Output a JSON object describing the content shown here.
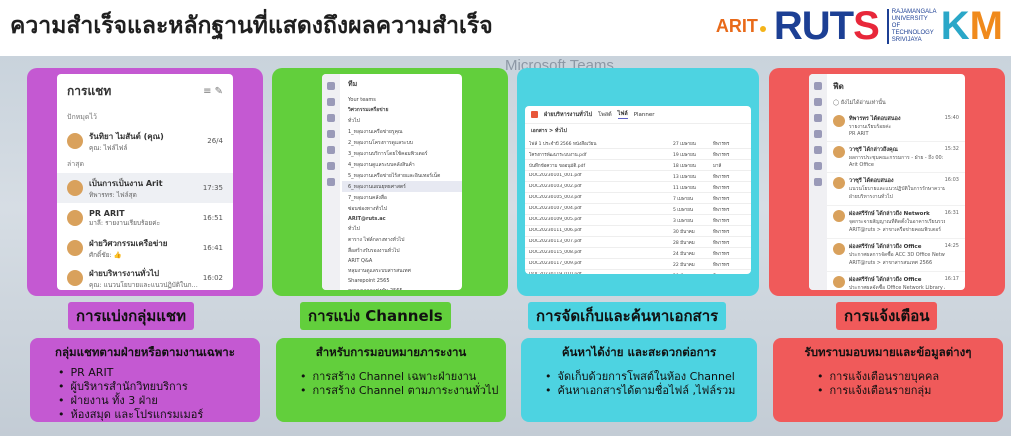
{
  "title": "ความสำเร็จและหลักฐานที่แสดงถึงผลความสำเร็จ",
  "logos": {
    "arit": "ARIT",
    "ruts": "RUTS",
    "ruts_sub": "RAJAMANGALA UNIVERSITY OF TECHNOLOGY SRIVIJAYA",
    "km": "KM"
  },
  "background_text": "Microsoft Teams",
  "colors": {
    "purple": "#c459d2",
    "green": "#62cf3c",
    "cyan": "#4dd3e1",
    "red": "#f05a5a"
  },
  "panels": [
    {
      "heading": "การแบ่งกลุ่มแชท",
      "desc_title": "กลุ่มแชทตามฝ่ายหรือตามงานเฉพาะ",
      "bullets": [
        "PR ARIT",
        "ผู้บริหารสำนักวิทยบริการ",
        "ฝ่ายงาน ทั้ง 3 ฝ่าย",
        "ห้องสมุด และโปรแกรมเมอร์"
      ],
      "screen": {
        "title": "การแชท",
        "pinned_label": "ปักหมุดไว้",
        "recent_label": "ล่าสุด",
        "items": [
          {
            "name": "รันทิยา ไมสันต์ (คุณ)",
            "sub": "คุณ: ไฟล์ไฟล์",
            "time": "26/4"
          },
          {
            "name": "เป็นการเป็นงาน Arit",
            "sub": "ทิพารทร: ไฟล์สุด",
            "time": "17:35"
          },
          {
            "name": "PR ARIT",
            "sub": "มาลี: รายงานเรียบร้อยค่ะ",
            "time": "16:51"
          },
          {
            "name": "ฝ่ายวิศวกรรมเครือข่าย",
            "sub": "ศักดิ์ชัย: 👍",
            "time": "16:41"
          },
          {
            "name": "ฝ่ายบริหารงานทั่วไป",
            "sub": "คุณ: แนวนโยบายและแนวปฏิบัติในก...",
            "time": "16:02"
          }
        ]
      }
    },
    {
      "heading": "การแบ่ง Channels",
      "desc_title": "สำหรับการมอบหมายภาระงาน",
      "bullets": [
        "การสร้าง Channel เฉพาะฝ่ายงาน",
        "การสร้าง Channel ตามภาระงานทั่วไป"
      ],
      "screen": {
        "title": "ทีม",
        "lines": [
          "Your teams",
          "วิศวกรรมเครือข่าย",
          "ทั่วไป",
          "1_หลุมงานเครือข่ายรูคุณ",
          "2_หลุมงานโครงการดูแลระบบ",
          "3_หลุมงานบริการโดยใช้คอมพิวเตอร์",
          "4_หลุมงานดูแลระบบคลังสินค้า",
          "5_หลุมงานเครือข่ายไร้สายและอินเทอร์เน็ต",
          "6_หลุมงานแผนยุทธศาสตร์",
          "7_หลุมงานคลังสื่อ",
          "ซ่อนช่องทางทั่วไป",
          "ARIT@ruts.ac",
          "ทั่วไป",
          "ตาราง ไฟล์กลางทางทั่วไป",
          "สื่อสร้างรับรองงานทั่วไป",
          "ARIT Q&A",
          "หลุมงานดูแลระบบสารสนเทศ",
          "Sharepoint 2565",
          "ตารางเวลาแข่งขัน 2565",
          "การตรวจสอบข้อมูล 2566"
        ]
      }
    },
    {
      "heading": "การจัดเก็บและค้นหาเอกสาร",
      "desc_title": "ค้นหาได้ง่าย และสะดวกต่อการ",
      "bullets": [
        "จัดเก็บด้วยการโพสต์ในห้อง Channel",
        "ค้นหาเอกสารได้ตามชื่อไฟล์ ,ไฟล์รวม"
      ],
      "screen": {
        "title": "ฝ่ายบริหารงานทั่วไป",
        "tabs": [
          "โพสต์",
          "ไฟล์",
          "Planner"
        ],
        "files_label": "เอกสาร > ทั่วไป",
        "rows": [
          {
            "name": "ไฟล์ 1 ประจำปี 2566 หนังสือเวียน",
            "date": "27 เมษายน",
            "by": "ทิพารทร"
          },
          {
            "name": "โครงการพัฒนาระบบงาน.pdf",
            "date": "19 เมษายน",
            "by": "ทิพารทร"
          },
          {
            "name": "บันทึกข้อความ ขออนุมัติ.pdf",
            "date": "18 เมษายน",
            "by": "มาลี"
          },
          {
            "name": "DOC20230101_001.pdf",
            "date": "13 เมษายน",
            "by": "ทิพารทร"
          },
          {
            "name": "DOC20230103_002.pdf",
            "date": "11 เมษายน",
            "by": "ทิพารทร"
          },
          {
            "name": "DOC20230105_003.pdf",
            "date": "7 เมษายน",
            "by": "ทิพารทร"
          },
          {
            "name": "DOC20230107_004.pdf",
            "date": "5 เมษายน",
            "by": "ทิพารทร"
          },
          {
            "name": "DOC20230109_005.pdf",
            "date": "3 เมษายน",
            "by": "ทิพารทร"
          },
          {
            "name": "DOC20230111_006.pdf",
            "date": "30 มีนาคม",
            "by": "ทิพารทร"
          },
          {
            "name": "DOC20230113_007.pdf",
            "date": "28 มีนาคม",
            "by": "ทิพารทร"
          },
          {
            "name": "DOC20230115_008.pdf",
            "date": "24 มีนาคม",
            "by": "ทิพารทร"
          },
          {
            "name": "DOC20230117_009.pdf",
            "date": "22 มีนาคม",
            "by": "ทิพารทร"
          },
          {
            "name": "DOC20230119_010.pdf",
            "date": "20 มีนาคม",
            "by": "ทิพารทร"
          },
          {
            "name": "DOC20230121_011.pdf",
            "date": "16 มีนาคม",
            "by": "ทิพารทร"
          },
          {
            "name": "DOC20230123_012.pdf",
            "date": "14 มีนาคม",
            "by": "ทิพารทร"
          }
        ]
      }
    },
    {
      "heading": "การแจ้งเตือน",
      "desc_title": "รับทราบมอบหมายและข้อมูลต่างๆ",
      "bullets": [
        "การแจ้งเตือนรายบุคคล",
        "การแจ้งเตือนรายกลุ่ม"
      ],
      "screen": {
        "title": "ฟีด",
        "toggle_label": "ยังไม่ได้อ่านเท่านั้น",
        "items": [
          {
            "name": "ทิพารทร ได้ตอบสนอง",
            "sub": "รายงานเรียบร้อยค่ะ",
            "sub2": "PR ARIT",
            "time": "15:40"
          },
          {
            "name": "วาซุรี ได้กล่าวถึงคุณ",
            "sub": "ผลการประชุมคณะกรรมการ - ฝ่าย - ถึง 00: 00 ...",
            "sub2": "Arit Office",
            "time": "15:32"
          },
          {
            "name": "วาซุรี ได้ตอบสนอง",
            "sub": "แนวนโยบายและแนวปฏิบัติในการรักษาความ...",
            "sub2": "ฝ่ายบริหารงานทั่วไป",
            "time": "16:03"
          },
          {
            "name": "ผ่องศรีรักษ์ ได้กล่าวถึง Network",
            "sub": "จุดกระจายสัญญาณที่ติดตั้งในอาคารเรียนรวม...",
            "sub2": "ARIT@ruts > สาขาเครือข่ายคอมพิวเตอร์",
            "time": "16:31"
          },
          {
            "name": "ผ่องศรีรักษ์ ได้กล่าวถึง Office",
            "sub": "ประกาศผลการจัดซื้อ ACC 3D Office Network L...",
            "sub2": "ARIT@ruts > สาขาสารสนเทศ 2566",
            "time": "14:25"
          },
          {
            "name": "ผ่องศรีรักษ์ ได้กล่าวถึง Office",
            "sub": "ประกาศผลจัดซื้อ Office Network Library A...",
            "sub2": "ARIT@ruts > สาขาสารสนเทศ 2566",
            "time": "16:17"
          }
        ]
      }
    }
  ]
}
